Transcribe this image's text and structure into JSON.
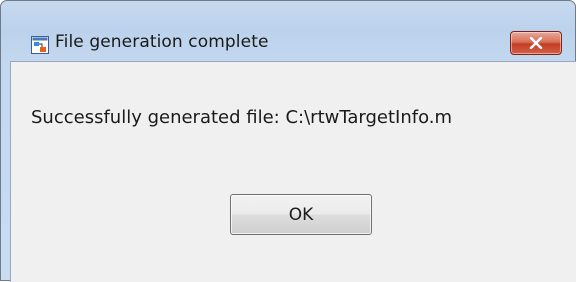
{
  "window": {
    "title": "File generation complete",
    "app_icon": "simulink-model-icon",
    "close_icon": "close-icon"
  },
  "dialog": {
    "message": "Successfully generated file: C:\\rtwTargetInfo.m",
    "ok_label": "OK"
  },
  "colors": {
    "title_bar": "#c6d9ef",
    "close_button": "#c94a30",
    "client_background": "#f0f0f0"
  }
}
